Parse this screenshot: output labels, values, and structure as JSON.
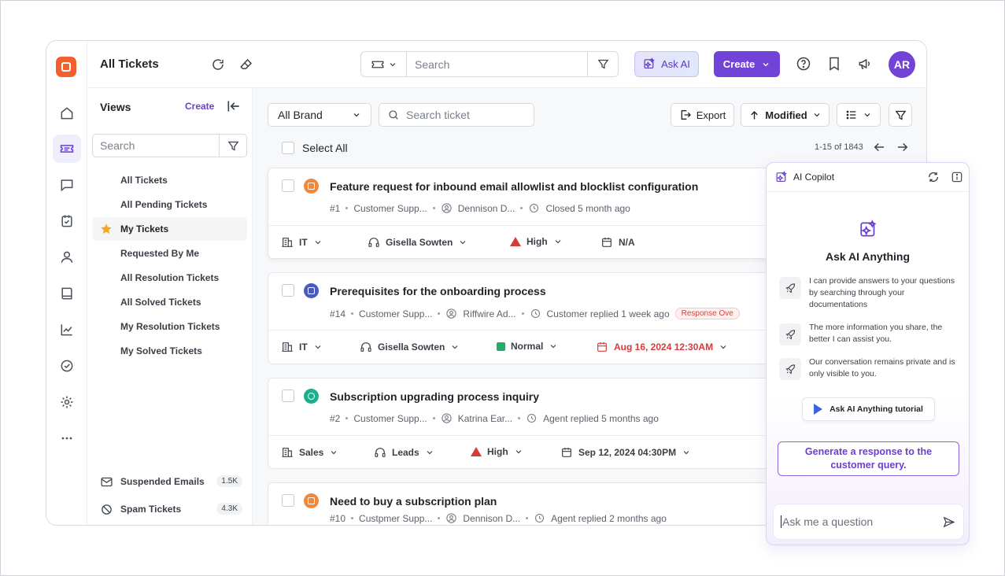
{
  "header": {
    "title": "All Tickets",
    "search_placeholder": "Search",
    "ask_ai_label": "Ask AI",
    "create_label": "Create",
    "avatar_initials": "AR"
  },
  "views": {
    "title": "Views",
    "create_label": "Create",
    "search_placeholder": "Search",
    "items": [
      {
        "label": "All Tickets"
      },
      {
        "label": "All Pending Tickets"
      },
      {
        "label": "My Tickets"
      },
      {
        "label": "Requested By Me"
      },
      {
        "label": "All Resolution Tickets"
      },
      {
        "label": "All Solved Tickets"
      },
      {
        "label": "My Resolution Tickets"
      },
      {
        "label": "My Solved Tickets"
      }
    ],
    "footer": [
      {
        "label": "Suspended Emails",
        "count": "1.5K"
      },
      {
        "label": "Spam Tickets",
        "count": "4.3K"
      }
    ]
  },
  "toolbar": {
    "brand_select": "All Brand",
    "ticket_search_placeholder": "Search ticket",
    "export_label": "Export",
    "sort_label": "Modified",
    "select_all_label": "Select All",
    "pagination": "1-15 of 1843"
  },
  "tickets": [
    {
      "title": "Feature request for inbound email allowlist and blocklist configuration",
      "id": "#1",
      "group": "Customer Supp...",
      "contact": "Dennison D...",
      "status": "Closed 5 month ago",
      "team": "IT",
      "agent": "Gisella Sowten",
      "priority": "High",
      "due": "N/A",
      "icon_color": "#f0873f"
    },
    {
      "title": "Prerequisites for the onboarding process",
      "id": "#14",
      "group": "Customer Supp...",
      "contact": "Riffwire Ad...",
      "status": "Customer replied 1 week ago",
      "badge": "Response Ove",
      "team": "IT",
      "agent": "Gisella Sowten",
      "priority": "Normal",
      "due": "Aug 16, 2024 12:30AM",
      "icon_color": "#4b5bb8"
    },
    {
      "title": "Subscription upgrading process inquiry",
      "id": "#2",
      "group": "Customer Supp...",
      "contact": "Katrina Ear...",
      "status": "Agent replied 5 months ago",
      "team": "Sales",
      "agent": "Leads",
      "priority": "High",
      "due": "Sep 12, 2024 04:30PM",
      "icon_color": "#1fae8b"
    },
    {
      "title": "Need to buy a subscription plan",
      "id": "#10",
      "group": "Custpmer Supp...",
      "contact": "Dennison D...",
      "status": "Agent replied 2 months ago",
      "icon_color": "#f0873f"
    }
  ],
  "copilot": {
    "title": "AI Copilot",
    "hero": "Ask AI Anything",
    "tips": [
      "I can provide answers to your questions by searching through your documentations",
      "The more information you share, the better I can assist you.",
      "Our conversation remains private and is only visible to you."
    ],
    "tutorial_label": "Ask AI Anything tutorial",
    "generate_label": "Generate a response to the customer query.",
    "input_placeholder": "Ask me a question"
  },
  "colors": {
    "accent": "#7143d6",
    "brand_logo": "#f2612d",
    "priority_high": "#d63b3b",
    "priority_normal": "#1fae6b"
  }
}
